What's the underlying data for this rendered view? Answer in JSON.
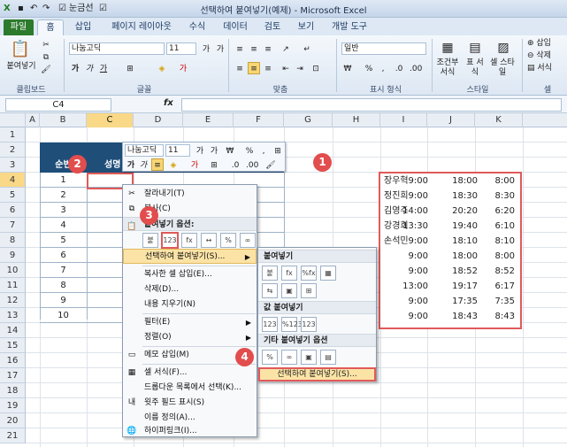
{
  "window": {
    "title": "선택하여 붙여넣기(예제) - Microsoft Excel",
    "quick_access": "눈금선"
  },
  "tabs": [
    "파일",
    "홈",
    "삽입",
    "페이지 레이아웃",
    "수식",
    "데이터",
    "검토",
    "보기",
    "개발 도구"
  ],
  "ribbon": {
    "paste_label": "붙여넣기",
    "font_name": "나눔고딕",
    "font_size": "11",
    "number_format": "일반",
    "insert_label": "삽입",
    "delete_label": "삭제",
    "format_label": "서식",
    "cond_format_label": "조건부 서식",
    "table_format_label": "표 서식",
    "cell_style_label": "셀 스타일",
    "groups": [
      "클립보드",
      "글꼴",
      "맞춤",
      "표시 형식",
      "스타일",
      "셀"
    ]
  },
  "formula_bar": {
    "name_box": "C4",
    "fx": "fx",
    "formula": ""
  },
  "grid": {
    "columns": [
      "A",
      "B",
      "C",
      "D",
      "E",
      "F",
      "G",
      "H",
      "I",
      "J",
      "K"
    ],
    "rows": [
      "1",
      "2",
      "3",
      "4",
      "5",
      "6",
      "7",
      "8",
      "9",
      "10",
      "11",
      "12",
      "13",
      "14",
      "15",
      "16",
      "17",
      "18",
      "19",
      "20",
      "21"
    ],
    "table_headers": [
      "순번",
      "성명"
    ],
    "numbers": [
      "1",
      "2",
      "3",
      "4",
      "5",
      "6",
      "7",
      "8",
      "9",
      "10"
    ]
  },
  "mini_toolbar": {
    "font": "나눔고딕",
    "size": "11"
  },
  "context_menu": {
    "cut": "잘라내기(T)",
    "copy": "복사(C)",
    "paste_options": "붙여넣기 옵션:",
    "paste_icons": [
      "붙",
      "123",
      "fx",
      "↔",
      "%",
      "∞"
    ],
    "paste_special": "선택하여 붙여넣기(S)...",
    "insert_copied": "복사한 셀 삽입(E)...",
    "delete": "삭제(D)...",
    "clear": "내용 지우기(N)",
    "filter": "필터(E)",
    "sort": "정렬(O)",
    "insert_comment": "메모 삽입(M)",
    "format_cells": "셀 서식(F)...",
    "dropdown": "드롭다운 목록에서 선택(K)...",
    "phonetic": "윗주 필드 표시(S)",
    "define_name": "이름 정의(A)...",
    "hyperlink": "하이퍼링크(I)..."
  },
  "submenu": {
    "paste_header": "붙여넣기",
    "paste_icons": [
      "붙",
      "fx",
      "%fx",
      "▦",
      "⇆",
      "▣",
      "⊞"
    ],
    "values_header": "값 붙여넣기",
    "values_icons": [
      "123",
      "%123",
      "123"
    ],
    "other_header": "기타 붙여넣기 옵션",
    "other_icons": [
      "%",
      "∞",
      "▣",
      "▤"
    ],
    "paste_special": "선택하여 붙여넣기(S)..."
  },
  "pasted_data": [
    {
      "name": "장우혁",
      "start": "9:00",
      "end": "18:00",
      "hours": "8:00"
    },
    {
      "name": "정진희",
      "start": "9:00",
      "end": "18:30",
      "hours": "8:30"
    },
    {
      "name": "김영주",
      "start": "14:00",
      "end": "20:20",
      "hours": "6:20"
    },
    {
      "name": "강경희",
      "start": "13:30",
      "end": "19:40",
      "hours": "6:10"
    },
    {
      "name": "손석민",
      "start": "9:00",
      "end": "18:10",
      "hours": "8:10"
    },
    {
      "name": "",
      "start": "9:00",
      "end": "18:00",
      "hours": "8:00"
    },
    {
      "name": "",
      "start": "9:00",
      "end": "18:52",
      "hours": "8:52"
    },
    {
      "name": "",
      "start": "13:00",
      "end": "19:17",
      "hours": "6:17"
    },
    {
      "name": "",
      "start": "9:00",
      "end": "17:35",
      "hours": "7:35"
    },
    {
      "name": "",
      "start": "9:00",
      "end": "18:43",
      "hours": "8:43"
    }
  ],
  "badges": [
    "1",
    "2",
    "3",
    "4"
  ],
  "colors": {
    "accent_red": "#e24d4d",
    "table_header": "#1f4e79",
    "file_tab": "#2c7a2c"
  }
}
